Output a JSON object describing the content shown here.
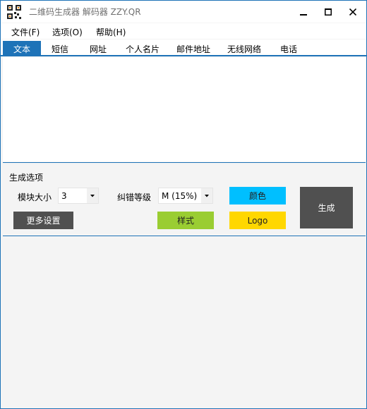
{
  "window": {
    "title": "二维码生成器 解码器 ZZY.QR",
    "controls": {
      "minimize_icon": "minimize-icon",
      "maximize_icon": "maximize-icon",
      "close_icon": "close-icon"
    }
  },
  "menu": {
    "file": "文件(F)",
    "options": "选项(O)",
    "help": "帮助(H)"
  },
  "tabs": [
    {
      "label": "文本",
      "active": true
    },
    {
      "label": "短信",
      "active": false
    },
    {
      "label": "网址",
      "active": false
    },
    {
      "label": "个人名片",
      "active": false
    },
    {
      "label": "邮件地址",
      "active": false
    },
    {
      "label": "无线网络",
      "active": false
    },
    {
      "label": "电话",
      "active": false
    }
  ],
  "text_input": {
    "value": ""
  },
  "generate_options": {
    "section_label": "生成选项",
    "module_size_label": "模块大小",
    "module_size_value": "3",
    "ecc_label": "纠错等级",
    "ecc_value": "M (15%)",
    "more_settings_label": "更多设置",
    "style_label": "样式",
    "color_label": "颜色",
    "logo_label": "Logo",
    "generate_label": "生成"
  },
  "colors": {
    "accent": "#1e73b8",
    "color_button": "#00bfff",
    "logo_button": "#ffd700",
    "style_button": "#9acd32",
    "dark_button": "#505050",
    "background": "#f4f4f4"
  }
}
